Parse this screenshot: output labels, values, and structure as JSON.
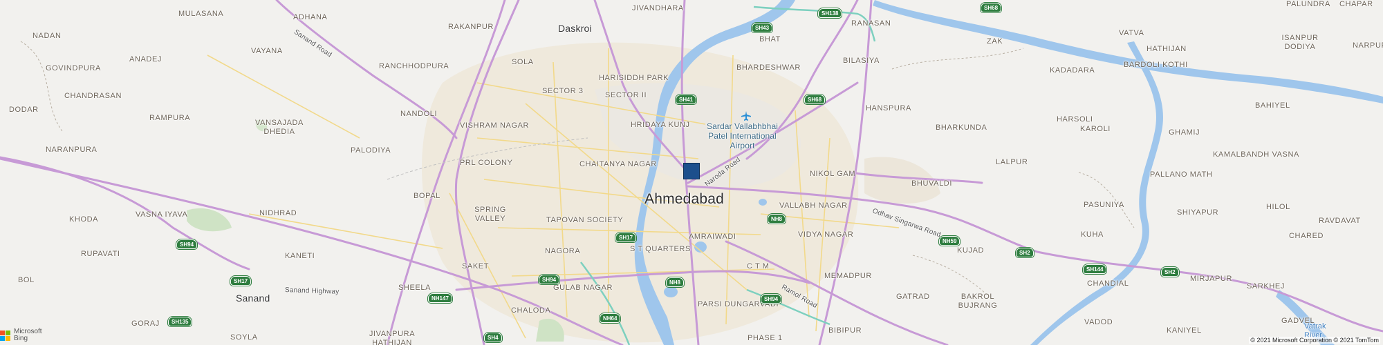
{
  "map": {
    "attribution": "© 2021 Microsoft Corporation © 2021 TomTom",
    "logo": {
      "line1": "Microsoft",
      "line2": "Bing",
      "colors": [
        "#f25022",
        "#7fba00",
        "#00a4ef",
        "#ffb900"
      ]
    },
    "pin_color": "#1c4f8c",
    "cities": [
      {
        "name": "Ahmedabad",
        "kind": "city"
      },
      {
        "name": "Daskroi",
        "kind": "town"
      },
      {
        "name": "Sanand",
        "kind": "town"
      }
    ],
    "localities": [
      "MULASANA",
      "ADHANA",
      "JIVANDHARA",
      "RAKANPUR",
      "NADAN",
      "ANADEJ",
      "VAYANA",
      "SOLA",
      "RANCHHODPURA",
      "GOVINDPURA",
      "CHANDRASAN",
      "HARISIDDH PARK",
      "SECTOR 3",
      "SECTOR II",
      "BHAT",
      "BHARDESHWAR",
      "RANASAN",
      "ZAK",
      "VATVA",
      "HATHIJAN",
      "ISANPUR DODIYA",
      "NARPURA",
      "KADADARA",
      "BARDOLI KOTHI",
      "BILASIYA",
      "DODAR",
      "RAMPURA",
      "NANDOLI",
      "VISHRAM NAGAR",
      "HRIDAYA KUNJ",
      "HANSPURA",
      "HARSOLI",
      "BAHIYEL",
      "VANSAJADA DHEDIA",
      "BHARKUNDA",
      "KAROLI",
      "GHAMIJ",
      "NARANPURA",
      "PALODIYA",
      "PRL COLONY",
      "CHAITANYA NAGAR",
      "NIKOL GAM",
      "LALPUR",
      "KAMALBANDH VASNA",
      "BOPAL",
      "BHUVALDI",
      "PALLANO MATH",
      "VASNA IYAVA",
      "KHODA",
      "NIDHRAD",
      "SPRING VALLEY",
      "TAPOVAN SOCIETY",
      "VALLABH NAGAR",
      "PASUNIYA",
      "SHIYAPUR",
      "HILOL",
      "RAVDAVAT",
      "AMRAIWADI",
      "VIDYA NAGAR",
      "KUHA",
      "CHARED",
      "RUPAVATI",
      "KANETI",
      "NAGORA",
      "S T QUARTERS",
      "SAKET",
      "C T M",
      "KUJAD",
      "BOL",
      "MEMADPUR",
      "CHANDIAL",
      "MIRJAPUR",
      "SARKHEJ",
      "SHEELA",
      "GULAB NAGAR",
      "GATRAD",
      "BAKROL BUJRANG",
      "CHALODA",
      "PARSI DUNGARVADI",
      "GORAJ",
      "VADOD",
      "KANIYEL",
      "GADVEL",
      "BIBIPUR",
      "JIVANPURA HATHIJAN",
      "SOYLA",
      "PHASE 1",
      "PALUNDRA",
      "CHAPAR"
    ],
    "poi": {
      "name": "Sardar Vallabhbhai Patel International Airport",
      "line1": "Sardar Vallabhbhai",
      "line2": "Patel International",
      "line3": "Airport",
      "icon": "airplane-icon"
    },
    "river": {
      "line1": "Vatrak",
      "line2": "River"
    },
    "road_names": [
      "Sanand Road",
      "Naroda Road",
      "Odhav Singarwa Road",
      "Sanand Highway",
      "Ramol Road"
    ],
    "shields": [
      "SH43",
      "SH138",
      "SH68",
      "SH41",
      "SH68",
      "NH8",
      "NH59",
      "SH2",
      "SH144",
      "SH2",
      "SH94",
      "SH17",
      "SH17",
      "SH94",
      "NH8",
      "NH147",
      "SH94",
      "NH64",
      "SH135",
      "SH4"
    ]
  }
}
